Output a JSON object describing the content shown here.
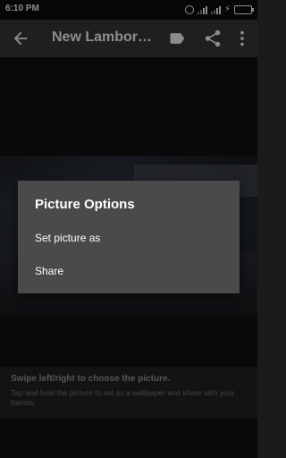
{
  "status_bar": {
    "time": "6:10 PM",
    "icons": [
      "alarm-icon",
      "signal-icon",
      "signal-icon",
      "charging-icon",
      "battery-icon"
    ],
    "battery_color": "#5ad45a"
  },
  "app_bar": {
    "title": "New Lamborg…",
    "icons": [
      "back-arrow-icon",
      "label-tag-icon",
      "share-icon",
      "more-vert-icon"
    ]
  },
  "hint": {
    "title": "Swipe left/right to choose the picture.",
    "text": "Tap and hold the picture to set as a wallpaper and share with your friends."
  },
  "dialog": {
    "title": "Picture Options",
    "items": [
      {
        "label": "Set picture as"
      },
      {
        "label": "Share"
      }
    ]
  }
}
